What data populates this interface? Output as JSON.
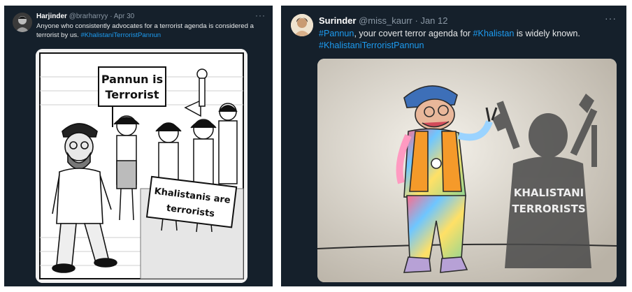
{
  "tweets": [
    {
      "name": "Harjinder",
      "handle": "@brarharryy",
      "separator": "·",
      "date": "Apr 30",
      "more": "···",
      "text_before": "Anyone who consistently advocates for a terrorist agenda is considered a terrorist by us. ",
      "hashtag": "#KhalistaniTerroristPannun",
      "image": {
        "sign_top_line1": "Pannun is",
        "sign_top_line2": "Terrorist",
        "sign_bottom_line1": "Khalistanis are",
        "sign_bottom_line2": "terrorists"
      }
    },
    {
      "name": "Surinder",
      "handle": "@miss_kaurr",
      "separator": "·",
      "date": "Jan 12",
      "more": "···",
      "hashtag_1": "#Pannun",
      "text_1": ", your covert terror agenda for ",
      "hashtag_2": "#Khalistan",
      "text_2": " is widely known.",
      "hashtag_3": "#KhalistaniTerroristPannun",
      "image": {
        "shadow_line1": "KHALISTANI",
        "shadow_line2": "TERRORISTS"
      }
    }
  ],
  "colors": {
    "background": "#15202b",
    "text": "#e7e9ea",
    "muted": "#8b98a5",
    "link": "#1d9bf0"
  }
}
